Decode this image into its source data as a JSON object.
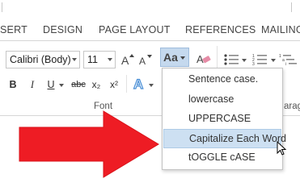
{
  "tabs": [
    "SERT",
    "DESIGN",
    "PAGE LAYOUT",
    "REFERENCES",
    "MAILING"
  ],
  "font": {
    "name": "Calibri (Body)",
    "size": "11"
  },
  "group_labels": {
    "font": "Font",
    "paragraph_partial": "aragr"
  },
  "case_button": {
    "label": "Aa"
  },
  "format_buttons": [
    "B",
    "I",
    "U",
    "abc",
    "x₂",
    "x²"
  ],
  "change_case_menu": {
    "items": [
      "Sentence case.",
      "lowercase",
      "UPPERCASE",
      "Capitalize Each Word",
      "tOGGLE cASE"
    ],
    "highlighted_index": 3
  },
  "colors": {
    "arrow": "#ee1c24",
    "highlight": "#cde0f2",
    "pressed": "#c5d9ee"
  }
}
